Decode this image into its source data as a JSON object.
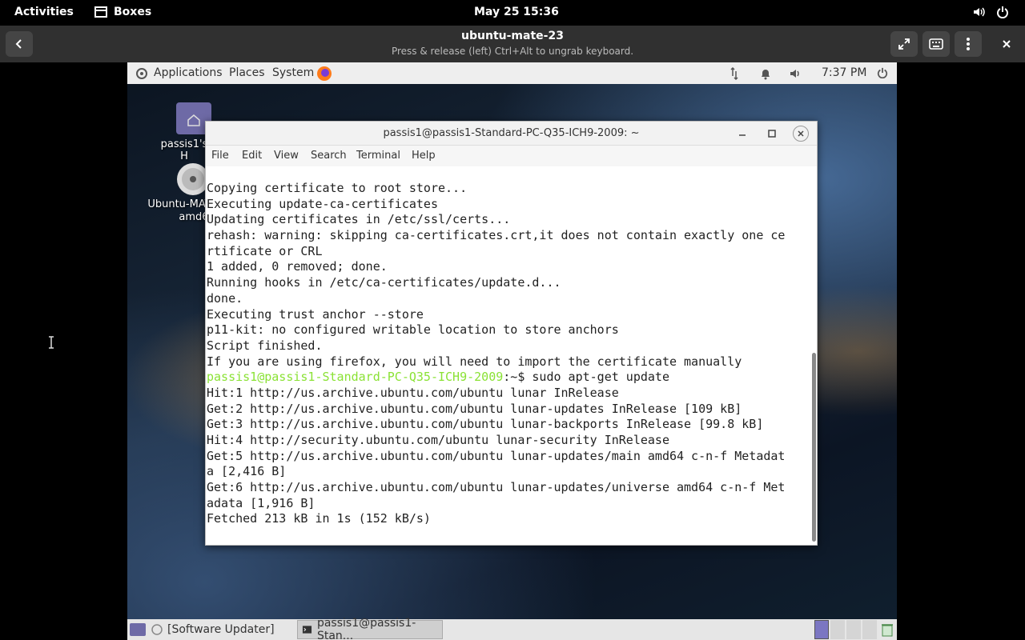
{
  "gnome": {
    "activities": "Activities",
    "app_name": "Boxes",
    "clock": "May 25  15:36"
  },
  "boxes": {
    "title": "ubuntu-mate-23",
    "subtitle": "Press & release (left) Ctrl+Alt to ungrab keyboard."
  },
  "mate_panel": {
    "applications": "Applications",
    "places": "Places",
    "system": "System",
    "time": "7:37 PM"
  },
  "desktop": {
    "home_label": "passis1's H",
    "disc_label_1": "Ubuntu-MAT",
    "disc_label_2": "amd6"
  },
  "terminal": {
    "title": "passis1@passis1-Standard-PC-Q35-ICH9-2009: ~",
    "menu": [
      "File",
      "Edit",
      "View",
      "Search",
      "Terminal",
      "Help"
    ],
    "lines": [
      "Copying certificate to root store...",
      "Executing update-ca-certificates",
      "Updating certificates in /etc/ssl/certs...",
      "rehash: warning: skipping ca-certificates.crt,it does not contain exactly one ce",
      "rtificate or CRL",
      "1 added, 0 removed; done.",
      "Running hooks in /etc/ca-certificates/update.d...",
      "done.",
      "Executing trust anchor --store",
      "p11-kit: no configured writable location to store anchors",
      "Script finished.",
      "If you are using firefox, you will need to import the certificate manually"
    ],
    "prompt": "passis1@passis1-Standard-PC-Q35-ICH9-2009",
    "command": ":~$ sudo apt-get update",
    "lines_after": [
      "Hit:1 http://us.archive.ubuntu.com/ubuntu lunar InRelease",
      "Get:2 http://us.archive.ubuntu.com/ubuntu lunar-updates InRelease [109 kB]",
      "Get:3 http://us.archive.ubuntu.com/ubuntu lunar-backports InRelease [99.8 kB]",
      "Hit:4 http://security.ubuntu.com/ubuntu lunar-security InRelease",
      "Get:5 http://us.archive.ubuntu.com/ubuntu lunar-updates/main amd64 c-n-f Metadat",
      "a [2,416 B]",
      "Get:6 http://us.archive.ubuntu.com/ubuntu lunar-updates/universe amd64 c-n-f Met",
      "adata [1,916 B]",
      "Fetched 213 kB in 1s (152 kB/s)"
    ]
  },
  "taskbar": {
    "item1": "[Software Updater]",
    "item2": "passis1@passis1-Stan..."
  }
}
